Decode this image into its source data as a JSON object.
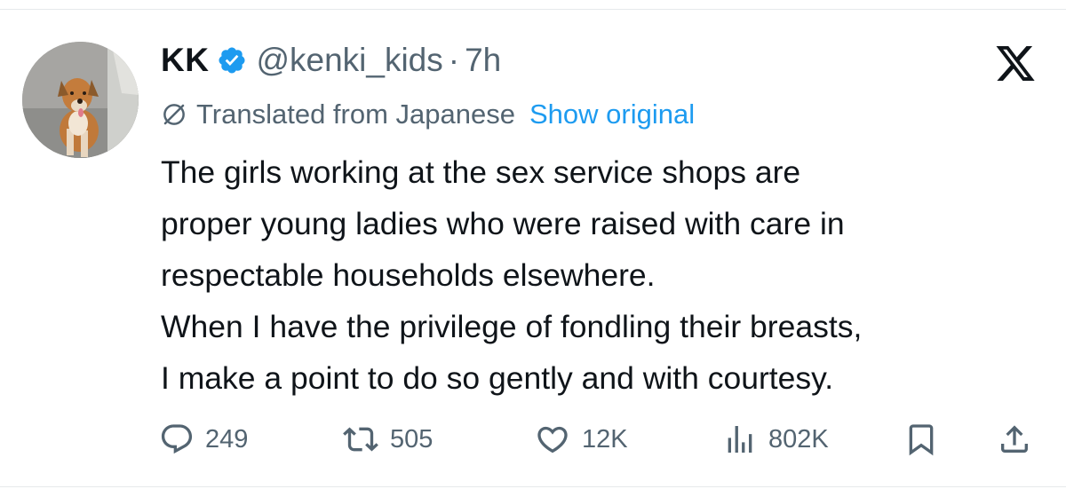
{
  "tweet": {
    "author": {
      "display_name": "KK",
      "handle": "@kenki_kids",
      "verified": true,
      "avatar_icon": "dog-photo-avatar"
    },
    "separator": "·",
    "timestamp": "7h",
    "platform_logo": "x-logo-icon",
    "translation": {
      "label": "Translated from Japanese",
      "link": "Show original"
    },
    "body": [
      "The girls working at the sex service shops are",
      "proper young ladies who were raised with care in",
      "respectable households elsewhere.",
      "When I have the privilege of fondling their breasts,",
      "I make a point to do so gently and with courtesy."
    ],
    "actions": {
      "replies": "249",
      "reposts": "505",
      "likes": "12K",
      "views": "802K"
    }
  },
  "colors": {
    "text": "#0f1419",
    "secondary": "#536471",
    "link": "#1d9bf0",
    "verified_badge": "#1d9bf0"
  }
}
